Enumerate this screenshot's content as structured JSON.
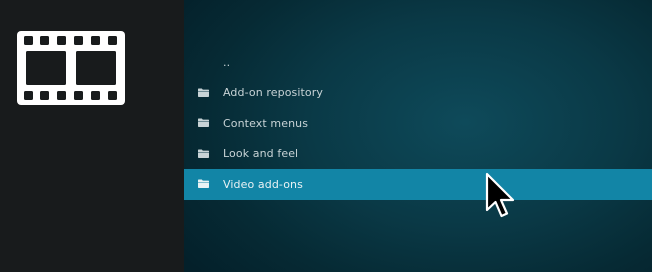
{
  "sidebar": {
    "icon": "film-strip-icon"
  },
  "list": {
    "items": [
      {
        "label": "..",
        "icon": "",
        "selected": false
      },
      {
        "label": "Add-on repository",
        "icon": "folder-icon",
        "selected": false
      },
      {
        "label": "Context menus",
        "icon": "folder-icon",
        "selected": false
      },
      {
        "label": "Look and feel",
        "icon": "folder-icon",
        "selected": false
      },
      {
        "label": "Video add-ons",
        "icon": "folder-icon",
        "selected": true
      }
    ]
  },
  "colors": {
    "sidebar_bg": "#181b1c",
    "content_bg": "#0a3946",
    "selection": "#1285a6",
    "text": "#c8d3d6"
  },
  "cursor": "mouse-pointer-icon"
}
